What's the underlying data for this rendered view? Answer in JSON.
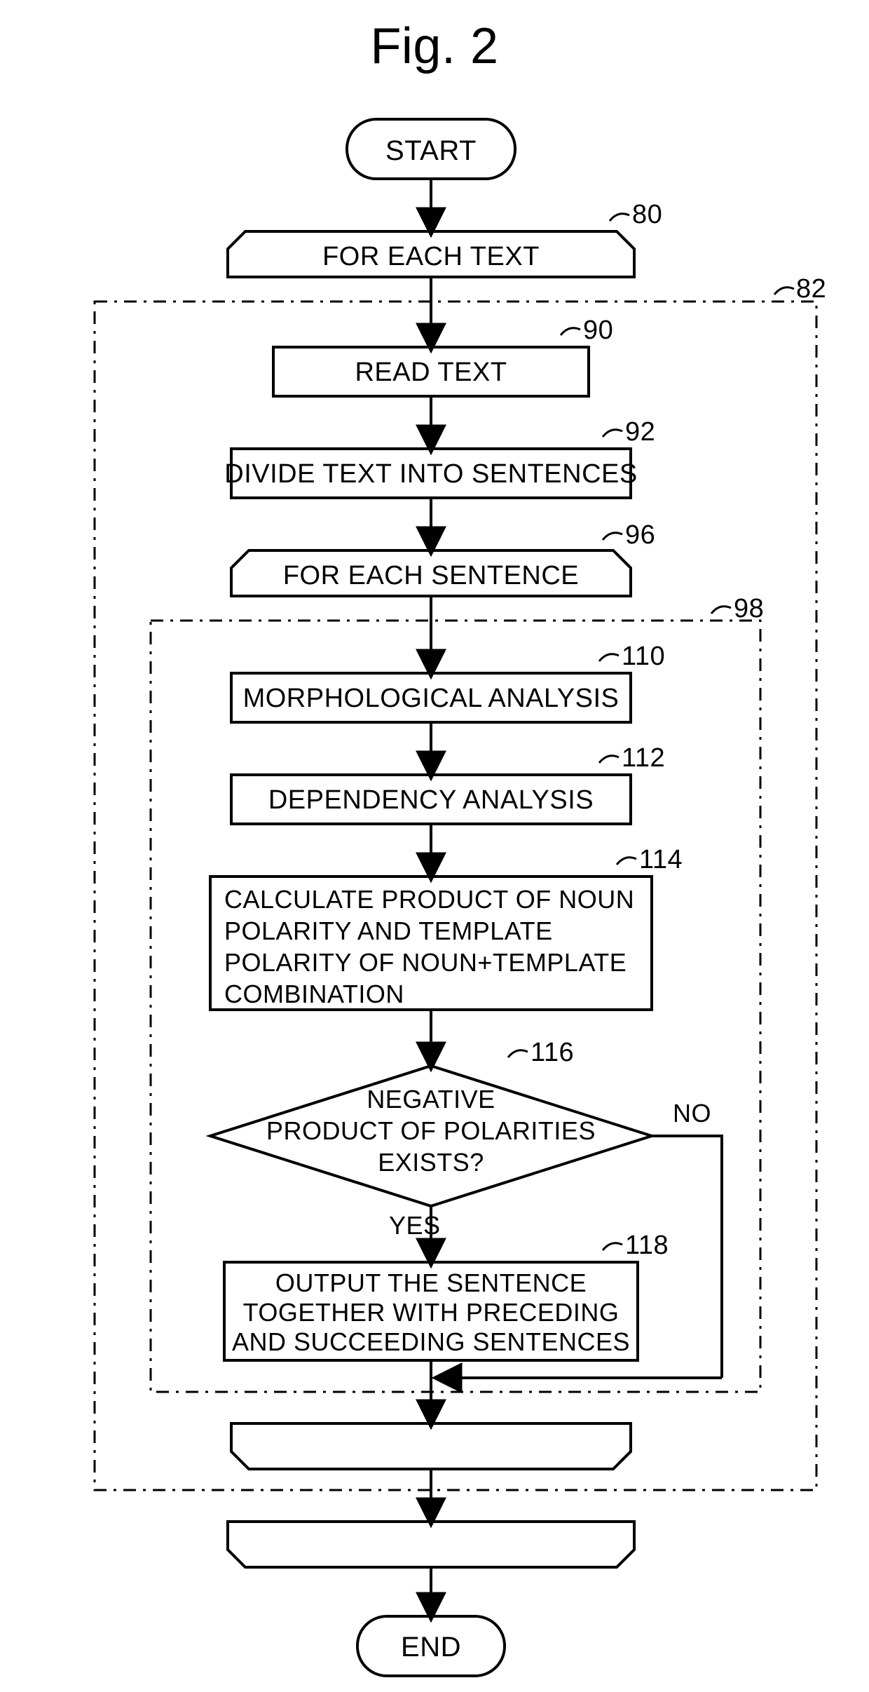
{
  "figure": {
    "title": "Fig. 2"
  },
  "nodes": {
    "start": "START",
    "end": "END",
    "loop_text": "FOR EACH TEXT",
    "read_text": "READ TEXT",
    "divide": "DIVIDE TEXT INTO SENTENCES",
    "loop_sentence": "FOR EACH SENTENCE",
    "morph": "MORPHOLOGICAL ANALYSIS",
    "dep": "DEPENDENCY ANALYSIS",
    "calc_l1": "CALCULATE PRODUCT OF NOUN",
    "calc_l2": "POLARITY AND TEMPLATE",
    "calc_l3": "POLARITY OF NOUN+TEMPLATE",
    "calc_l4": "COMBINATION",
    "decision_l1": "NEGATIVE",
    "decision_l2": "PRODUCT OF POLARITIES",
    "decision_l3": "EXISTS?",
    "out_l1": "OUTPUT THE SENTENCE",
    "out_l2": "TOGETHER WITH PRECEDING",
    "out_l3": "AND SUCCEEDING SENTENCES"
  },
  "edges": {
    "yes": "YES",
    "no": "NO"
  },
  "refs": {
    "r80": "80",
    "r82": "82",
    "r90": "90",
    "r92": "92",
    "r96": "96",
    "r98": "98",
    "r110": "110",
    "r112": "112",
    "r114": "114",
    "r116": "116",
    "r118": "118"
  }
}
